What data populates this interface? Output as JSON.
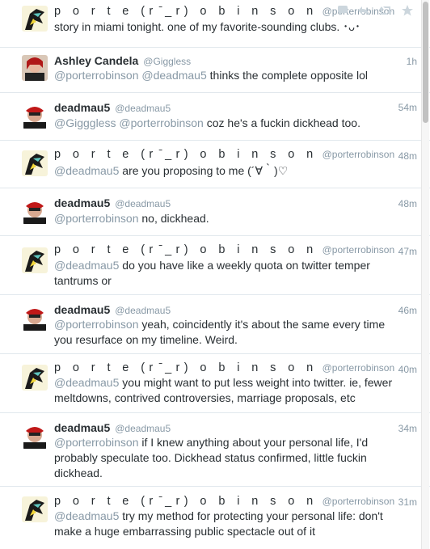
{
  "tweets": [
    {
      "name": "p o r t e (r ̄_r) o b i n s o n",
      "handle": "@porterrobinson",
      "time": "",
      "mention": "",
      "text": "story in miami tonight. one of my favorite-sounding clubs. ･ᴗ･",
      "avatar": "porter-avatar"
    },
    {
      "name": "Ashley Candela",
      "handle": "@Giggless",
      "time": "1h",
      "mention": "@porterrobinson @deadmau5",
      "text": " thinks the complete opposite lol",
      "avatar": "ashley-avatar"
    },
    {
      "name": "deadmau5",
      "handle": "@deadmau5",
      "time": "54m",
      "mention": "@Gigggless @porterrobinson",
      "text": " coz he's a fuckin dickhead too.",
      "avatar": "deadmau5-avatar"
    },
    {
      "name": "p o r t e (r ̄_r) o b i n s o n",
      "handle": "@porterrobinson",
      "time": "48m",
      "mention": "@deadmau5",
      "text": " are you proposing to me  (´∀｀)♡",
      "avatar": "porter-avatar"
    },
    {
      "name": "deadmau5",
      "handle": "@deadmau5",
      "time": "48m",
      "mention": "@porterrobinson",
      "text": " no, dickhead.",
      "avatar": "deadmau5-avatar"
    },
    {
      "name": "p o r t e (r ̄_r) o b i n s o n",
      "handle": "@porterrobinson",
      "time": "47m",
      "mention": "@deadmau5",
      "text": " do you have like a weekly quota on twitter temper tantrums or",
      "avatar": "porter-avatar"
    },
    {
      "name": "deadmau5",
      "handle": "@deadmau5",
      "time": "46m",
      "mention": "@porterrobinson",
      "text": " yeah, coincidently it's about the same every time you resurface on my timeline. Weird.",
      "avatar": "deadmau5-avatar"
    },
    {
      "name": "p o r t e (r ̄_r) o b i n s o n",
      "handle": "@porterrobinson",
      "time": "40m",
      "mention": "@deadmau5",
      "text": " you might want to put less weight into twitter. ie, fewer meltdowns, contrived controversies, marriage proposals, etc",
      "avatar": "porter-avatar"
    },
    {
      "name": "deadmau5",
      "handle": "@deadmau5",
      "time": "34m",
      "mention": "@porterrobinson",
      "text": " if I knew anything about your personal life, I'd probably speculate too. Dickhead status confirmed, little fuckin dickhead.",
      "avatar": "deadmau5-avatar"
    },
    {
      "name": "p o r t e (r ̄_r) o b i n s o n",
      "handle": "@porterrobinson",
      "time": "31m",
      "mention": "@deadmau5",
      "text": " try my method for protecting your personal life: don't make a huge embarrassing public spectacle out of it",
      "avatar": "porter-avatar"
    }
  ],
  "colors": {
    "text": "#292f33",
    "muted": "#8899a6",
    "divider": "#e1e8ed"
  }
}
